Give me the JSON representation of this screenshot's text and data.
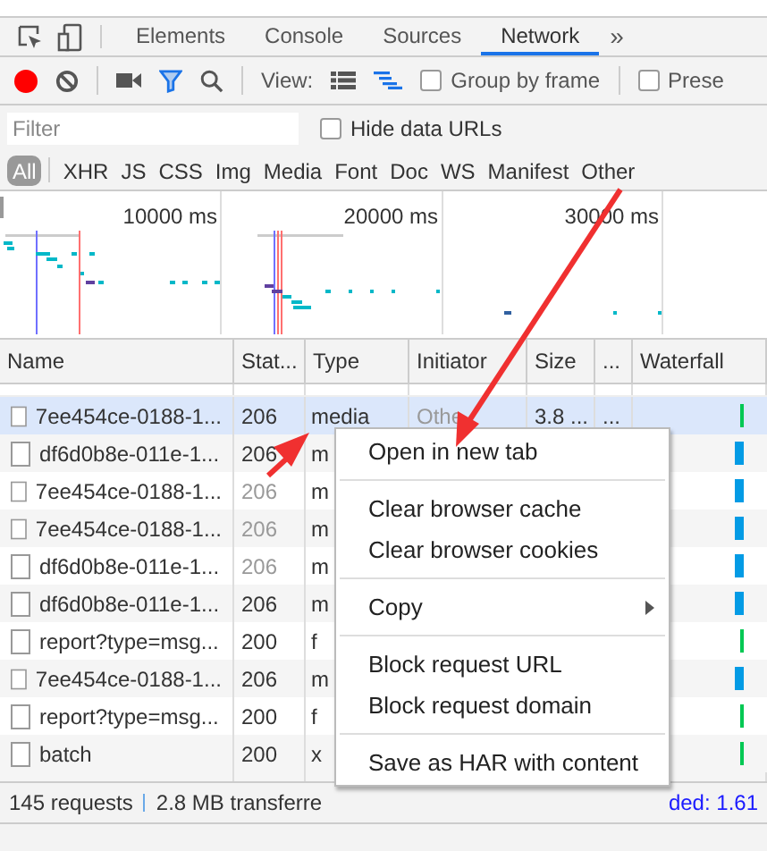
{
  "tabs": [
    {
      "label": "Elements",
      "selected": false
    },
    {
      "label": "Console",
      "selected": false
    },
    {
      "label": "Sources",
      "selected": false
    },
    {
      "label": "Network",
      "selected": true
    }
  ],
  "more_tabs": "»",
  "toolbar": {
    "recording": true,
    "filter_on": true,
    "view_label": "View:",
    "large_rows": false,
    "waterfall_view": true,
    "group_by_frame": {
      "label": "Group by frame",
      "checked": false
    },
    "preserve_log": {
      "label": "Prese",
      "checked": false
    }
  },
  "filter": {
    "placeholder": "Filter",
    "hide_data_urls": {
      "label": "Hide data URLs",
      "checked": false
    }
  },
  "types": [
    {
      "label": "All",
      "selected": true
    },
    {
      "label": "XHR",
      "selected": false
    },
    {
      "label": "JS",
      "selected": false
    },
    {
      "label": "CSS",
      "selected": false
    },
    {
      "label": "Img",
      "selected": false
    },
    {
      "label": "Media",
      "selected": false
    },
    {
      "label": "Font",
      "selected": false
    },
    {
      "label": "Doc",
      "selected": false
    },
    {
      "label": "WS",
      "selected": false
    },
    {
      "label": "Manifest",
      "selected": false
    },
    {
      "label": "Other",
      "selected": false
    }
  ],
  "overview": {
    "ticks": [
      "10000 ms",
      "20000 ms",
      "30000 ms"
    ]
  },
  "table": {
    "columns": [
      "Name",
      "Stat...",
      "Type",
      "Initiator",
      "Size",
      "...",
      "Waterfall"
    ],
    "rows": [
      {
        "name": "7ee454ce-0188-1...",
        "status": "206",
        "type": "media",
        "initiator": "Othe",
        "size": "3.8 ...",
        "time": "...",
        "selected": true,
        "dimmed": false,
        "color": "#00c853"
      },
      {
        "name": "df6d0b8e-011e-1...",
        "status": "206",
        "type": "m",
        "selected": false,
        "dimmed": false,
        "color": "#039be5"
      },
      {
        "name": "7ee454ce-0188-1...",
        "status": "206",
        "type": "m",
        "selected": false,
        "dimmed": true,
        "color": "#039be5"
      },
      {
        "name": "7ee454ce-0188-1...",
        "status": "206",
        "type": "m",
        "selected": false,
        "dimmed": true,
        "color": "#039be5"
      },
      {
        "name": "df6d0b8e-011e-1...",
        "status": "206",
        "type": "m",
        "selected": false,
        "dimmed": true,
        "color": "#039be5"
      },
      {
        "name": "df6d0b8e-011e-1...",
        "status": "206",
        "type": "m",
        "selected": false,
        "dimmed": false,
        "color": "#039be5"
      },
      {
        "name": "report?type=msg...",
        "status": "200",
        "type": "f",
        "selected": false,
        "dimmed": false,
        "color": "#00c853"
      },
      {
        "name": "7ee454ce-0188-1...",
        "status": "206",
        "type": "m",
        "selected": false,
        "dimmed": false,
        "color": "#039be5"
      },
      {
        "name": "report?type=msg...",
        "status": "200",
        "type": "f",
        "selected": false,
        "dimmed": false,
        "color": "#00c853"
      },
      {
        "name": "batch",
        "status": "200",
        "type": "x",
        "selected": false,
        "dimmed": false,
        "color": "#00c853"
      }
    ]
  },
  "status_bar": {
    "requests": "145 requests",
    "transferred": "2.8 MB transferre",
    "loaded": "ded: 1.61"
  },
  "context_menu": [
    {
      "kind": "item",
      "label": "Open in new tab"
    },
    {
      "kind": "separator"
    },
    {
      "kind": "item",
      "label": "Clear browser cache"
    },
    {
      "kind": "item",
      "label": "Clear browser cookies"
    },
    {
      "kind": "separator"
    },
    {
      "kind": "submenu",
      "label": "Copy"
    },
    {
      "kind": "separator"
    },
    {
      "kind": "item",
      "label": "Block request URL"
    },
    {
      "kind": "item",
      "label": "Block request domain"
    },
    {
      "kind": "separator"
    },
    {
      "kind": "item",
      "label": "Save as HAR with content"
    }
  ]
}
